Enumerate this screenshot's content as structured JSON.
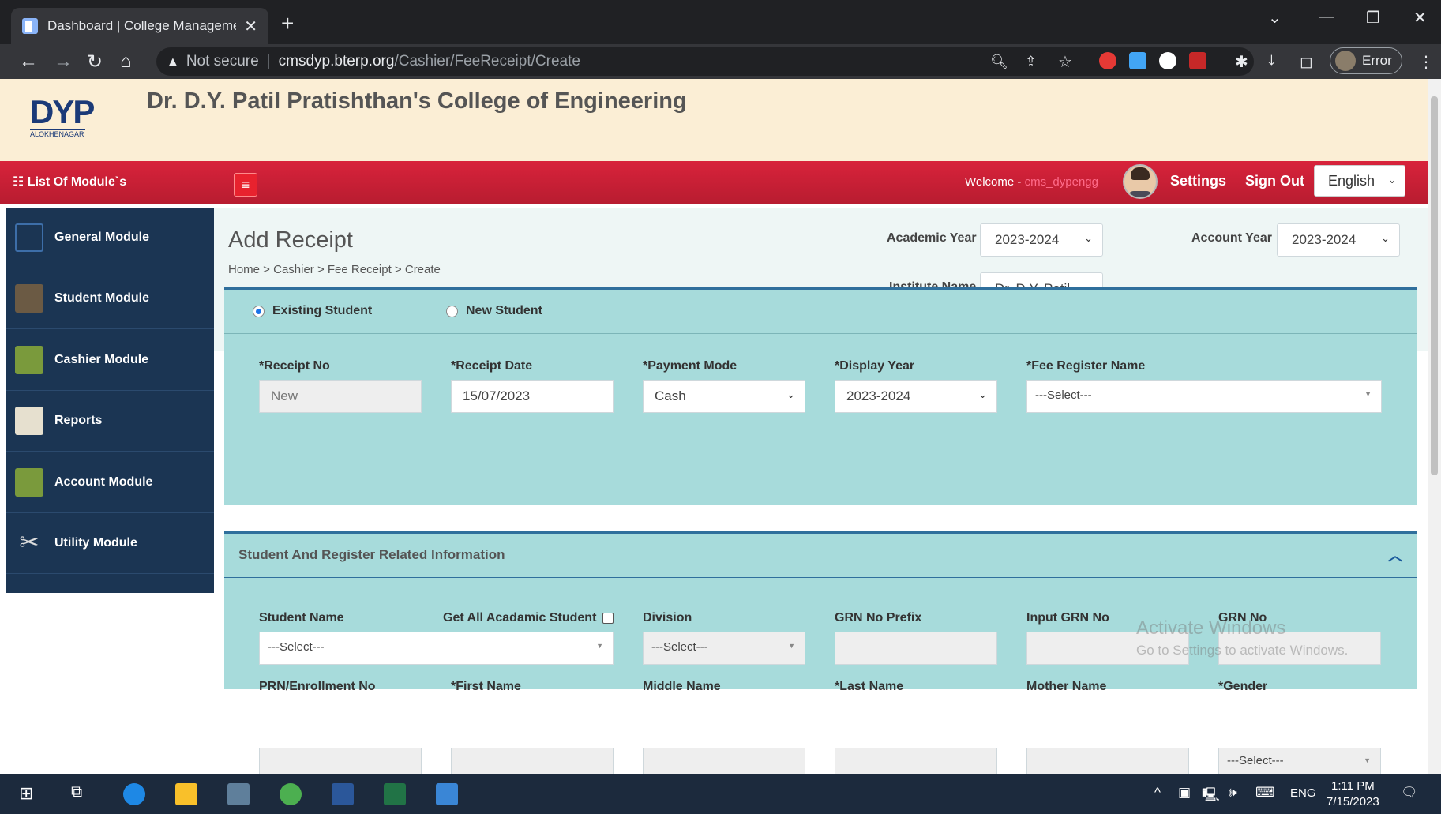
{
  "browser": {
    "tab_title": "Dashboard | College Managemer",
    "url_warning": "Not secure",
    "url_domain": "cmsdyp.bterp.org",
    "url_path": "/Cashier/FeeReceipt/Create",
    "profile_label": "Error"
  },
  "header": {
    "logo_text": "DYP",
    "logo_sub": "ALOKHENAGAR",
    "college_name": "Dr. D.Y. Patil Pratishthan's College of Engineering"
  },
  "topbar": {
    "modules_label": "List Of Module`s",
    "welcome_prefix": "Welcome - ",
    "username": "cms_dypengg",
    "settings": "Settings",
    "signout": "Sign Out",
    "language": "English"
  },
  "sidebar": {
    "items": [
      {
        "label": "General Module",
        "icon": "document-icon"
      },
      {
        "label": "Student Module",
        "icon": "graduates-icon"
      },
      {
        "label": "Cashier Module",
        "icon": "cashier-icon"
      },
      {
        "label": "Reports",
        "icon": "report-icon"
      },
      {
        "label": "Account Module",
        "icon": "account-icon"
      },
      {
        "label": "Utility Module",
        "icon": "tools-icon"
      }
    ]
  },
  "page": {
    "title": "Add Receipt",
    "breadcrumb": "Home > Cashier > Fee Receipt > Create",
    "academic_year_label": "Academic Year",
    "academic_year": "2023-2024",
    "account_year_label": "Account Year",
    "account_year": "2023-2024",
    "institute_label": "Institute Name",
    "institute": "Dr. D.Y. Patil"
  },
  "receipt_panel": {
    "existing_student": "Existing Student",
    "new_student": "New Student",
    "receipt_no_label": "*Receipt No",
    "receipt_no": "New",
    "receipt_date_label": "*Receipt Date",
    "receipt_date": "15/07/2023",
    "payment_mode_label": "*Payment Mode",
    "payment_mode": "Cash",
    "display_year_label": "*Display Year",
    "display_year": "2023-2024",
    "fee_register_label": "*Fee Register Name",
    "fee_register": "---Select---"
  },
  "student_panel": {
    "title": "Student And Register Related Information",
    "student_name_label": "Student Name",
    "student_name": "---Select---",
    "get_all_label": "Get All Acadamic Student",
    "division_label": "Division",
    "division": "---Select---",
    "grn_prefix_label": "GRN No Prefix",
    "input_grn_label": "Input GRN No",
    "grn_no_label": "GRN No",
    "prn_label": "PRN/Enrollment No",
    "first_name_label": "*First Name",
    "middle_name_label": "Middle Name",
    "last_name_label": "*Last Name",
    "mother_name_label": "Mother Name",
    "gender_label": "*Gender",
    "gender": "---Select---"
  },
  "watermark": {
    "line1": "Activate Windows",
    "line2": "Go to Settings to activate Windows."
  },
  "taskbar": {
    "lang": "ENG",
    "time": "1:11 PM",
    "date": "7/15/2023"
  }
}
